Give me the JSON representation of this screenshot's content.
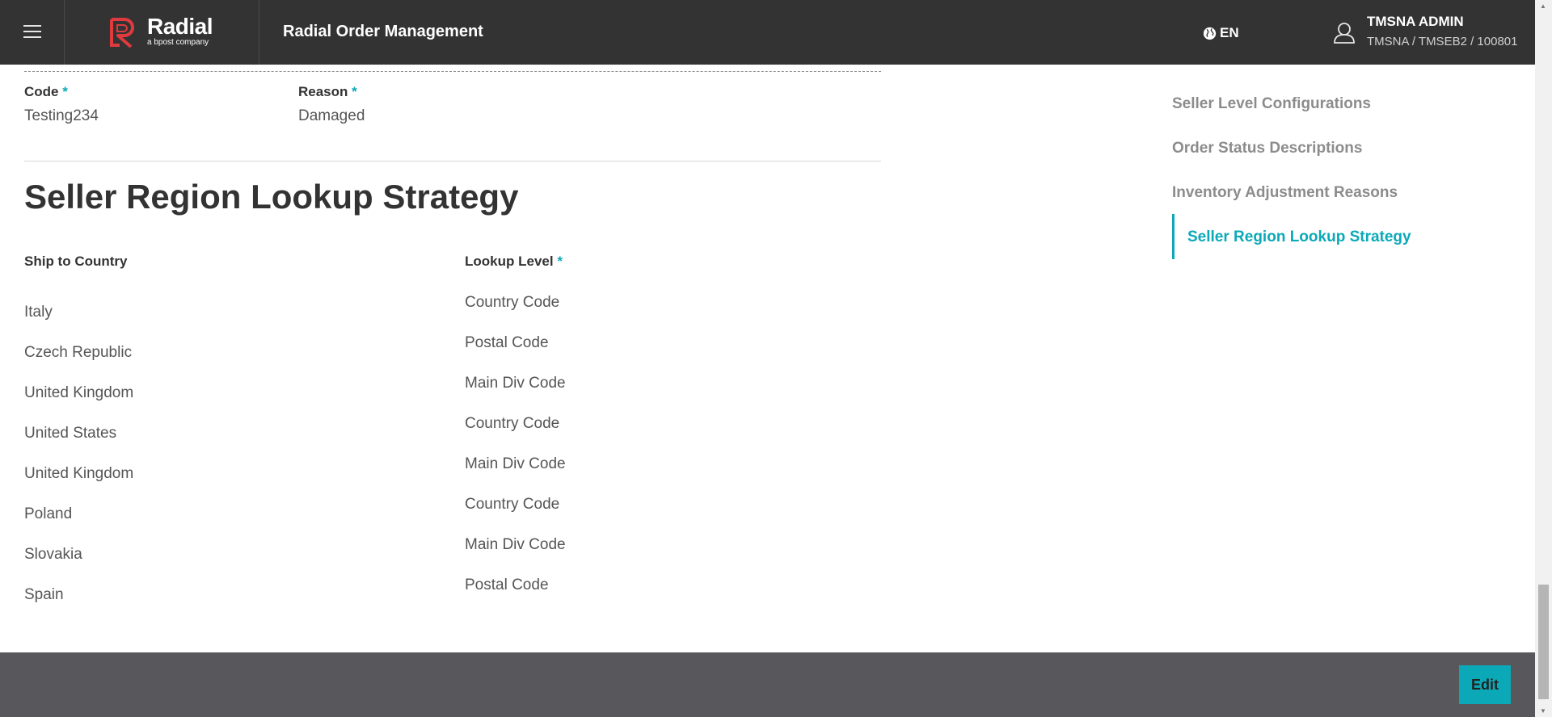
{
  "header": {
    "brand_name": "Radial",
    "brand_tagline": "a bpost company",
    "app_title": "Radial Order Management",
    "language": "EN",
    "user_name": "TMSNA ADMIN",
    "user_context": "TMSNA / TMSEB2 / 100801"
  },
  "inventory_reason": {
    "code_label": "Code",
    "code_value": "Testing234",
    "reason_label": "Reason",
    "reason_value": "Damaged",
    "required_mark": "*"
  },
  "section": {
    "title": "Seller Region Lookup Strategy",
    "col1_header": "Ship to Country",
    "col2_header": "Lookup Level",
    "countries": [
      "Italy",
      "Czech Republic",
      "United Kingdom",
      "United States",
      "United Kingdom",
      "Poland",
      "Slovakia",
      "Spain"
    ],
    "lookup_levels": [
      "Country Code",
      "Postal Code",
      "Main Div Code",
      "Country Code",
      "Main Div Code",
      "Country Code",
      "Main Div Code",
      "Postal Code"
    ]
  },
  "side_nav": {
    "items": [
      "Seller Level Configurations",
      "Order Status Descriptions",
      "Inventory Adjustment Reasons",
      "Seller Region Lookup Strategy"
    ],
    "active_index": 3
  },
  "footer": {
    "edit_label": "Edit"
  },
  "colors": {
    "accent": "#0ba9b8",
    "header_bg": "#333333",
    "footer_bg": "#58585c",
    "brand_red": "#e03a3e"
  }
}
